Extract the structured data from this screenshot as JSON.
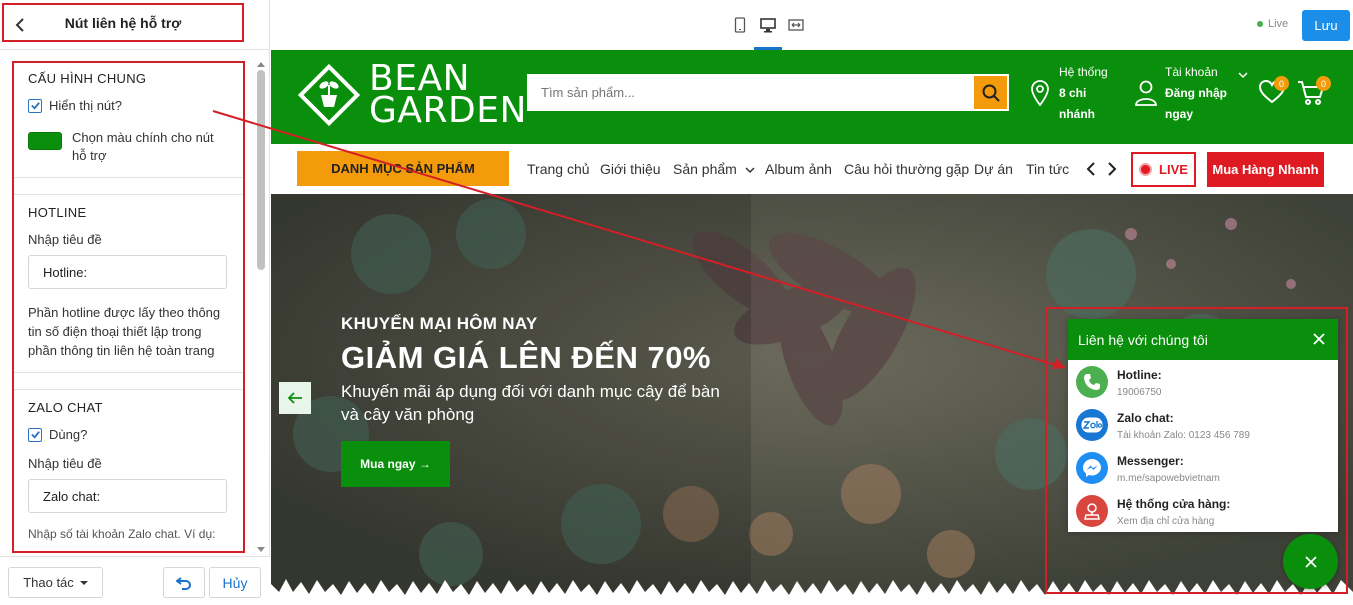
{
  "panel": {
    "title": "Nút liên hệ hỗ trợ",
    "general": {
      "heading": "CẤU HÌNH CHUNG",
      "show_button_label": "Hiển thị nút?",
      "show_button_checked": true,
      "color_label": "Chọn màu chính cho nút hỗ trợ",
      "main_color": "#0a8f0c"
    },
    "hotline": {
      "heading": "HOTLINE",
      "title_label": "Nhập tiêu đề",
      "title_value": "Hotline:",
      "help": "Phần hotline được lấy theo thông tin số điện thoại thiết lập trong phần thông tin liên hệ toàn trang"
    },
    "zalo": {
      "heading": "ZALO CHAT",
      "use_label": "Dùng?",
      "use_checked": true,
      "title_label": "Nhập tiêu đề",
      "title_value": "Zalo chat:",
      "cut_text": "Nhập số tài khoản Zalo chat. Ví dụ:"
    },
    "footer": {
      "actions_label": "Thao tác",
      "cancel_label": "Hủy"
    }
  },
  "topbar": {
    "live_label": "Live",
    "save_label": "Lưu"
  },
  "site": {
    "logo_line1": "BEAN",
    "logo_line2": "GARDEN",
    "search_placeholder": "Tìm sản phẩm...",
    "store_line1": "Hệ thống",
    "store_line2": "8 chi",
    "store_line3": "nhánh",
    "account_line1": "Tài khoản",
    "account_line2": "Đăng nhập",
    "account_line3": "ngay",
    "wish_count": "0",
    "cart_count": "0",
    "nav": {
      "category_label": "DANH MỤC SẢN PHẨM",
      "items": [
        "Trang chủ",
        "Giới thiệu",
        "Sản phẩm",
        "Album ảnh",
        "Câu hỏi thường gặp",
        "Dự án",
        "Tin tức"
      ],
      "live_label": "LIVE",
      "quick_buy_label": "Mua Hàng Nhanh"
    },
    "hero": {
      "subtitle": "KHUYẾN MẠI HÔM NAY",
      "title": "GIẢM GIÁ LÊN ĐẾN 70%",
      "description": "Khuyến mãi áp dụng đối với danh mục cây để bàn và cây văn phòng",
      "cta_label": "Mua ngay →"
    }
  },
  "widget": {
    "header": "Liên hệ với chúng tôi",
    "items": [
      {
        "title": "Hotline:",
        "sub": "19006750",
        "color": "#4caf50",
        "icon": "phone-icon"
      },
      {
        "title": "Zalo chat:",
        "sub": "Tài khoản Zalo: 0123 456 789",
        "color": "#1877d2",
        "icon": "zalo-icon"
      },
      {
        "title": "Messenger:",
        "sub": "m.me/sapowebvietnam",
        "color": "#1e8ef2",
        "icon": "messenger-icon"
      },
      {
        "title": "Hệ thống cửa hàng:",
        "sub": "Xem địa chỉ cửa hàng",
        "color": "#d9463e",
        "icon": "store-location-icon"
      }
    ]
  },
  "colors": {
    "brand_green": "#0a8f0c",
    "accent_orange": "#f49b0b",
    "annotation_red": "#d31f26",
    "save_blue": "#1a8ee8"
  }
}
